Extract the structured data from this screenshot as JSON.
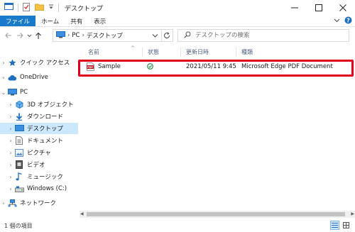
{
  "window": {
    "title": "デスクトップ"
  },
  "ribbon": {
    "tabs": [
      "ファイル",
      "ホーム",
      "共有",
      "表示"
    ]
  },
  "address": {
    "segments": [
      "PC",
      "デスクトップ"
    ],
    "search_placeholder": "デスクトップの検索"
  },
  "nav": {
    "items": [
      {
        "label": "クイック アクセス",
        "icon": "star-icon"
      },
      {
        "label": "OneDrive",
        "icon": "cloud-icon"
      },
      {
        "label": "PC",
        "icon": "pc-icon"
      },
      {
        "label": "3D オブジェクト",
        "icon": "3d-objects-icon"
      },
      {
        "label": "ダウンロード",
        "icon": "download-icon"
      },
      {
        "label": "デスクトップ",
        "icon": "desktop-folder-icon"
      },
      {
        "label": "ドキュメント",
        "icon": "documents-icon"
      },
      {
        "label": "ピクチャ",
        "icon": "pictures-icon"
      },
      {
        "label": "ビデオ",
        "icon": "video-icon"
      },
      {
        "label": "ミュージック",
        "icon": "music-icon"
      },
      {
        "label": "Windows (C:)",
        "icon": "drive-icon"
      },
      {
        "label": "ネットワーク",
        "icon": "network-icon"
      }
    ]
  },
  "columns": {
    "name": "名前",
    "status": "状態",
    "modified": "更新日時",
    "type": "種類"
  },
  "files": [
    {
      "name": "Sample",
      "status_icon": "synced-check-icon",
      "modified": "2021/05/11 9:45",
      "type": "Microsoft Edge PDF Document"
    }
  ],
  "status": {
    "count": "1 個の項目"
  },
  "colors": {
    "accent": "#1979ca",
    "selection": "#cce8ff",
    "highlight_border": "#e1001a",
    "folder": "#f3c244",
    "pdf": "#c4161c"
  }
}
